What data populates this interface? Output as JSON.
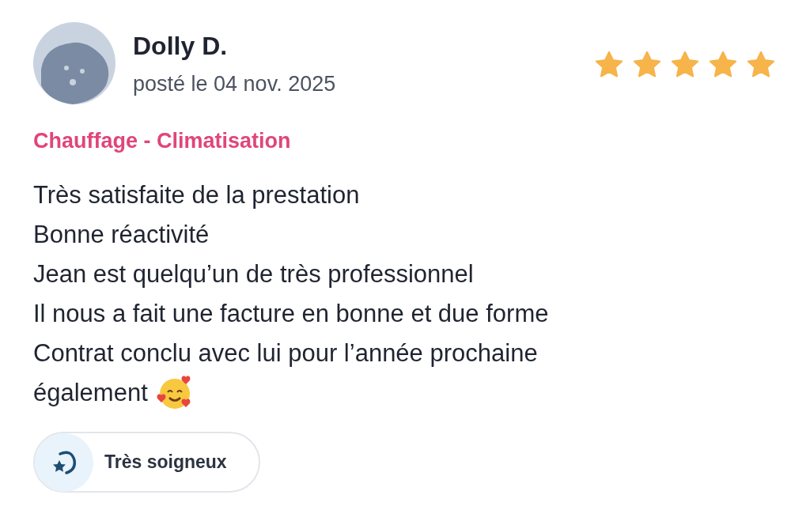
{
  "review": {
    "author": "Dolly D.",
    "date": "posté le 04 nov. 2025",
    "stars": 5,
    "category": "Chauffage - Climatisation",
    "lines": [
      "Très satisfaite de la prestation",
      "Bonne réactivité",
      "Jean est quelqu’un de très professionnel",
      "Il nous a fait une facture en bonne et due forme",
      "Contrat conclu avec lui pour l’année prochaine",
      "également"
    ],
    "badge": "Très soigneux"
  }
}
